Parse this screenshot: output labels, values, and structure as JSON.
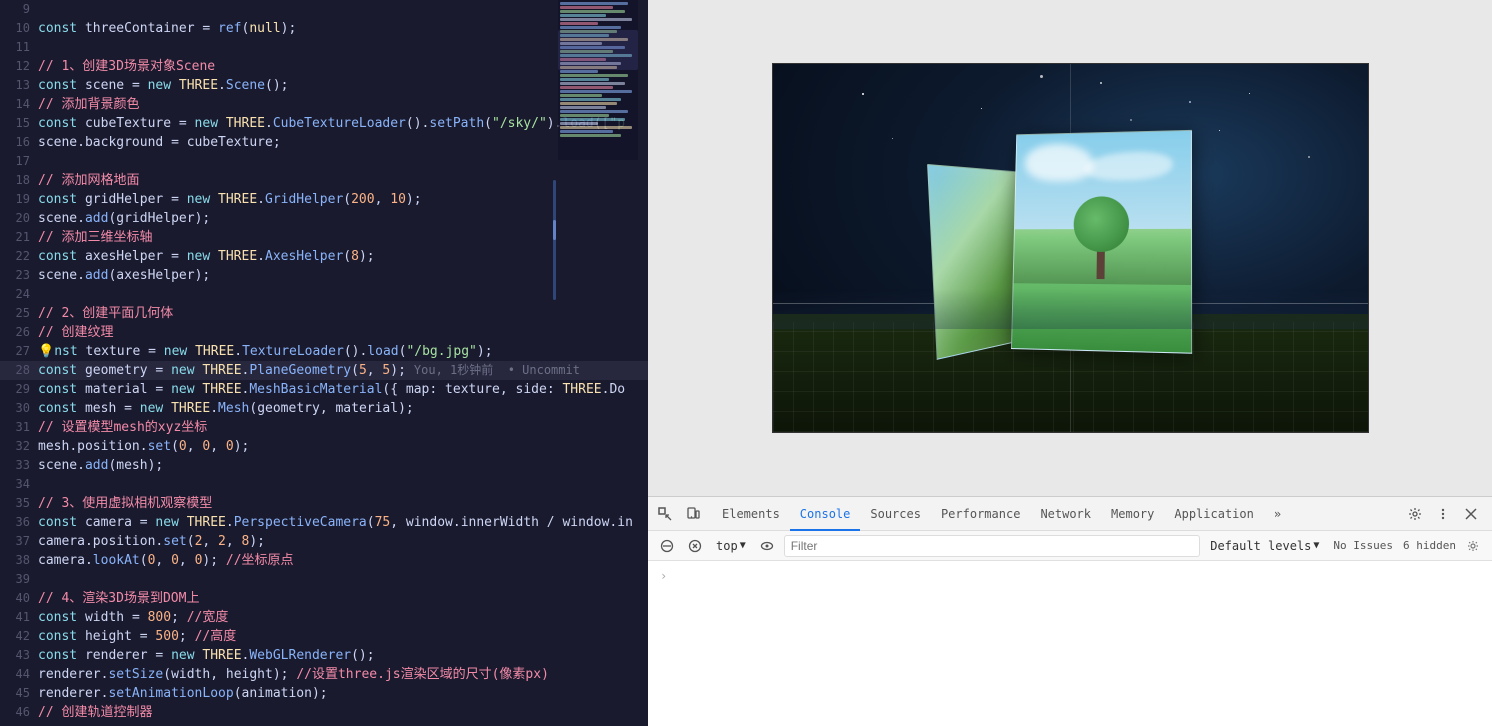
{
  "editor": {
    "lines": [
      {
        "num": "9",
        "tokens": []
      },
      {
        "num": "10",
        "code": "const threeContainer = ref(null);"
      },
      {
        "num": "11",
        "code": ""
      },
      {
        "num": "12",
        "comment": "// 1、创建3D场景对象Scene",
        "type": "comment-cn"
      },
      {
        "num": "13",
        "code": "const scene = new THREE.Scene();"
      },
      {
        "num": "14",
        "comment": "// 添加背景颜色",
        "type": "comment-cn"
      },
      {
        "num": "15",
        "code": "const cubeTexture = new THREE.CubeTextureLoader().setPath(\"/sky/\").load([\"p"
      },
      {
        "num": "16",
        "code": "scene.background = cubeTexture;"
      },
      {
        "num": "17",
        "code": ""
      },
      {
        "num": "18",
        "comment": "// 添加网格地面",
        "type": "comment-cn"
      },
      {
        "num": "19",
        "code": "const gridHelper = new THREE.GridHelper(200, 10);"
      },
      {
        "num": "20",
        "code": "scene.add(gridHelper);"
      },
      {
        "num": "21",
        "comment": "// 添加三维坐标轴",
        "type": "comment-cn"
      },
      {
        "num": "22",
        "code": "const axesHelper = new THREE.AxesHelper(8);"
      },
      {
        "num": "23",
        "code": "scene.add(axesHelper);"
      },
      {
        "num": "24",
        "code": ""
      },
      {
        "num": "25",
        "comment": "// 2、创建平面几何体",
        "type": "comment-cn"
      },
      {
        "num": "26",
        "comment": "// 创建纹理",
        "type": "comment-cn"
      },
      {
        "num": "27",
        "code": "🔦nst texture = new THREE.TextureLoader().load(\"/bg.jpg\");"
      },
      {
        "num": "28",
        "code": "const geometry = new THREE.PlaneGeometry(5, 5);"
      },
      {
        "num": "29",
        "code": "const material = new THREE.MeshBasicMaterial({ map: texture, side: THREE.Do"
      },
      {
        "num": "30",
        "code": "const mesh = new THREE.Mesh(geometry, material);"
      },
      {
        "num": "31",
        "comment": "// 设置模型mesh的xyz坐标",
        "type": "comment-cn"
      },
      {
        "num": "32",
        "code": "mesh.position.set(0, 0, 0);"
      },
      {
        "num": "33",
        "code": "scene.add(mesh);"
      },
      {
        "num": "34",
        "code": ""
      },
      {
        "num": "35",
        "comment": "// 3、使用虚拟相机观察模型",
        "type": "comment-cn"
      },
      {
        "num": "36",
        "code": "const camera = new THREE.PerspectiveCamera(75, window.innerWidth / window.in"
      },
      {
        "num": "37",
        "code": "camera.position.set(2, 2, 8);"
      },
      {
        "num": "38",
        "code": "camera.lookAt(0, 0, 0); //坐标原点"
      },
      {
        "num": "39",
        "code": ""
      },
      {
        "num": "40",
        "comment": "// 4、渲染3D场景到DOM上",
        "type": "comment-cn"
      },
      {
        "num": "41",
        "code": "const width = 800; //宽度"
      },
      {
        "num": "42",
        "code": "const height = 500; //高度"
      },
      {
        "num": "43",
        "code": "const renderer = new THREE.WebGLRenderer();"
      },
      {
        "num": "44",
        "code": "renderer.setSize(width, height); //设置three.js渲染区域的尺寸(像素px)"
      },
      {
        "num": "45",
        "code": "renderer.setAnimationLoop(animation);"
      },
      {
        "num": "46",
        "comment": "// 创建轨道控制器",
        "type": "comment-cn"
      }
    ],
    "hint_line_28": "You, 1秒钟前  • Uncommit"
  },
  "devtools": {
    "tabs": [
      "Elements",
      "Console",
      "Sources",
      "Performance",
      "Network",
      "Memory",
      "Application"
    ],
    "active_tab": "Console",
    "more_tabs_label": "»",
    "context": "top",
    "filter_placeholder": "Filter",
    "default_levels": "Default levels",
    "chevron": "▼",
    "issues_label": "No Issues",
    "hidden_label": "6 hidden",
    "console_chevron": "›"
  },
  "preview": {
    "scene_description": "Three.js 3D scene with plane geometry and sky background"
  }
}
